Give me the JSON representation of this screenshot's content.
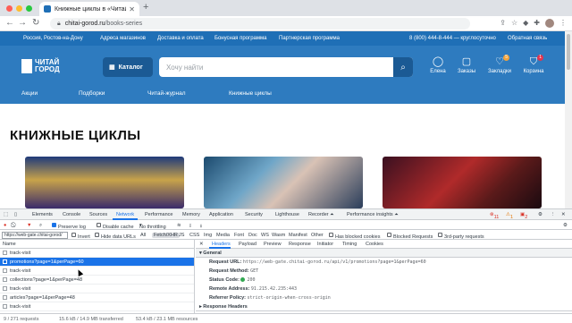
{
  "browser": {
    "tab_title": "Книжные циклы в «Читай-го...",
    "new_tab": "+",
    "url_host": "chitai-gorod.ru",
    "url_path": "/books-series",
    "window_colors": [
      "#ff5f57",
      "#febc2e",
      "#28c840"
    ]
  },
  "site": {
    "topbar": {
      "location": "Россия, Ростов-на-Дону",
      "links": [
        "Адреса магазинов",
        "Доставка и оплата",
        "Бонусная программа",
        "Партнерская программа"
      ],
      "phone": "8 (800) 444-8-444 — круглосуточно",
      "feedback": "Обратная связь"
    },
    "logo_line1": "ЧИТАЙ",
    "logo_line2": "ГОРОД",
    "catalog_label": "Каталог",
    "search_placeholder": "Хочу найти",
    "header_icons": [
      {
        "label": "Елена",
        "icon": "user-icon",
        "badge": ""
      },
      {
        "label": "Заказы",
        "icon": "box-icon",
        "badge": ""
      },
      {
        "label": "Закладки",
        "icon": "bookmark-icon",
        "badge": "5"
      },
      {
        "label": "Корзина",
        "icon": "cart-icon",
        "badge": "1"
      }
    ],
    "nav": [
      "Акции",
      "Подборки",
      "Читай-журнал",
      "Книжные циклы"
    ],
    "page_heading": "КНИЖНЫЕ ЦИКЛЫ",
    "accent": "#2e7bbf"
  },
  "devtools": {
    "tabs": [
      "Elements",
      "Console",
      "Sources",
      "Network",
      "Performance",
      "Memory",
      "Application",
      "Security",
      "Lighthouse",
      "Recorder ⏶",
      "Performance insights ⏶"
    ],
    "active_tab": "Network",
    "errors": "11",
    "warnings": "1",
    "issues": "2",
    "preserve_log": "Preserve log",
    "disable_cache": "Disable cache",
    "throttling": "No throttling",
    "filter_value": "https://web-gate.chitai-gorod/",
    "filter_opts": [
      "Invert",
      "Hide data URLs",
      "All",
      "Fetch/XHR",
      "JS",
      "CSS",
      "Img",
      "Media",
      "Font",
      "Doc",
      "WS",
      "Wasm",
      "Manifest",
      "Other",
      "Has blocked cookies",
      "Blocked Requests",
      "3rd-party requests"
    ],
    "name_header": "Name",
    "requests": [
      {
        "name": "track-visit",
        "selected": false
      },
      {
        "name": "promotions?page=1&perPage=60",
        "selected": true
      },
      {
        "name": "track-visit",
        "selected": false
      },
      {
        "name": "collections?page=1&perPage=48",
        "selected": false
      },
      {
        "name": "track-visit",
        "selected": false
      },
      {
        "name": "articles?page=1&perPage=48",
        "selected": false
      },
      {
        "name": "track-visit",
        "selected": false
      }
    ],
    "status": {
      "requests": "9 / 271 requests",
      "transferred": "15.6 kB / 14.9 MB transferred",
      "resources": "53.4 kB / 23.1 MB resources"
    },
    "detail_tabs": [
      "Headers",
      "Payload",
      "Preview",
      "Response",
      "Initiator",
      "Timing",
      "Cookies"
    ],
    "general_title": "General",
    "general": {
      "request_url_label": "Request URL:",
      "request_url": "https://web-gate.chitai-gorod.ru/api/v1/promotions?page=1&perPage=60",
      "method_label": "Request Method:",
      "method": "GET",
      "status_label": "Status Code:",
      "status": "200",
      "remote_label": "Remote Address:",
      "remote": "91.215.42.235:443",
      "referrer_label": "Referrer Policy:",
      "referrer": "strict-origin-when-cross-origin"
    },
    "response_headers_title": "Response Headers"
  }
}
